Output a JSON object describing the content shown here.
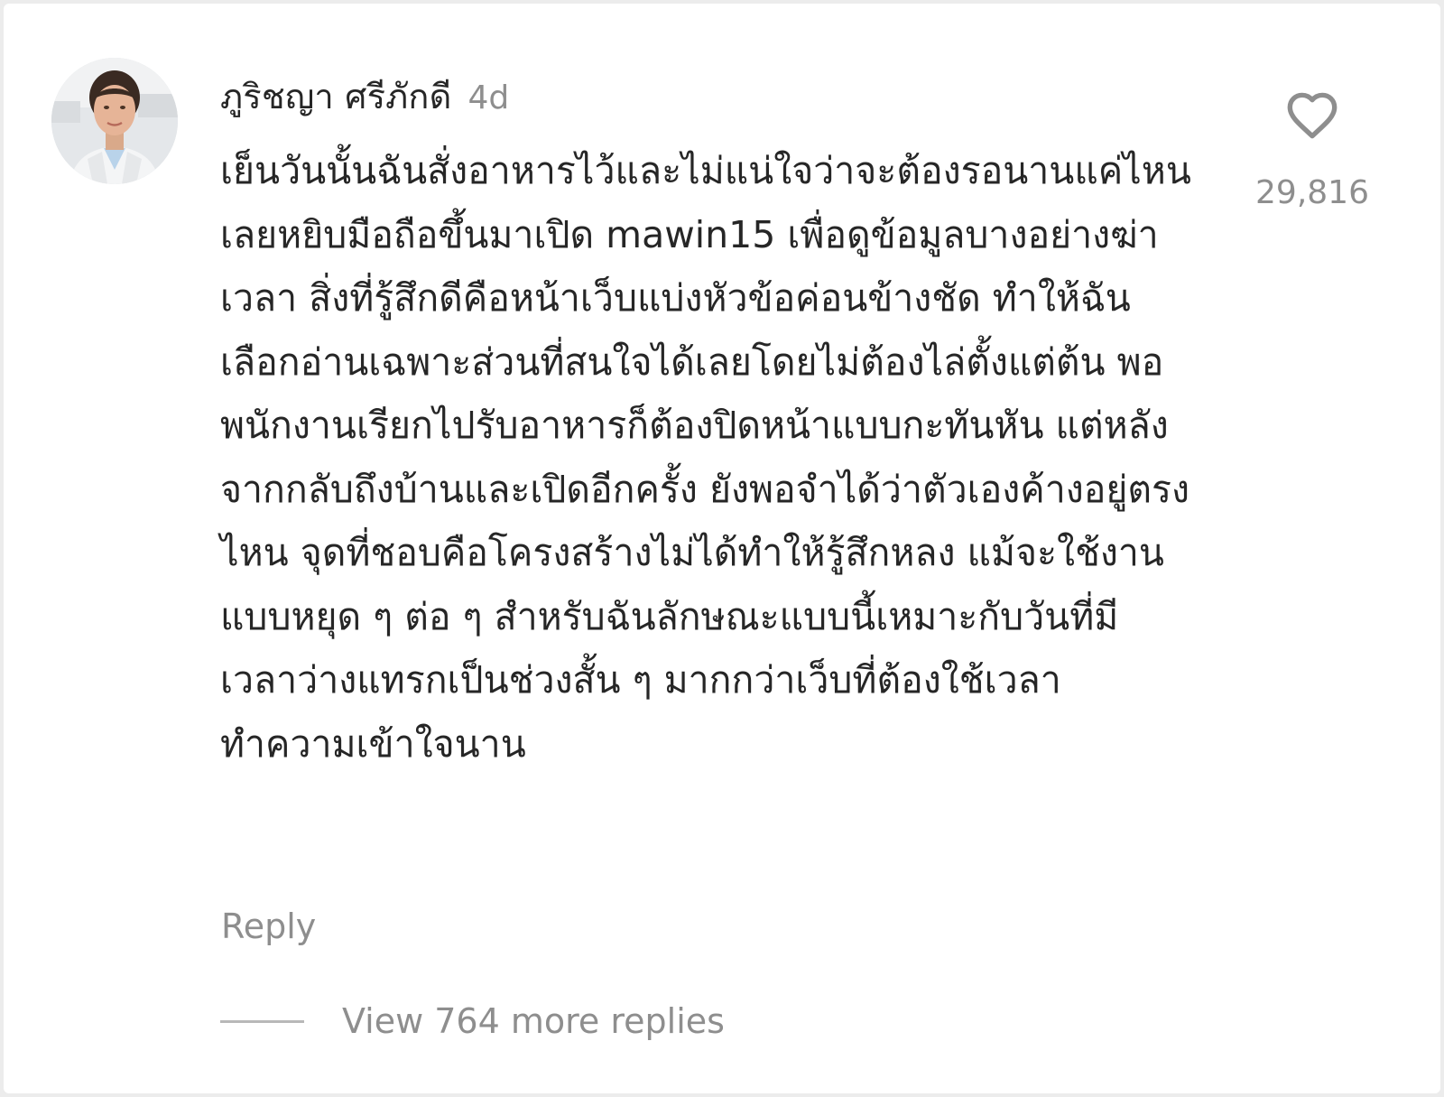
{
  "comment": {
    "username": "ภูริชญา ศรีภักดี",
    "time": "4d",
    "text": "เย็นวันนั้นฉันสั่งอาหารไว้และไม่แน่ใจว่าจะต้องรอนานแค่ไหน เลยหยิบมือถือขึ้นมาเปิด mawin15 เพื่อดูข้อมูลบางอย่างฆ่าเวลา สิ่งที่รู้สึกดีคือหน้าเว็บแบ่งหัวข้อค่อนข้างชัด ทำให้ฉันเลือกอ่านเฉพาะส่วนที่สนใจได้เลยโดยไม่ต้องไล่ตั้งแต่ต้น พอพนักงานเรียกไปรับอาหารก็ต้องปิดหน้าแบบกะทันหัน แต่หลังจากกลับถึงบ้านและเปิดอีกครั้ง ยังพอจำได้ว่าตัวเองค้างอยู่ตรงไหน จุดที่ชอบคือโครงสร้างไม่ได้ทำให้รู้สึกหลง แม้จะใช้งานแบบหยุด ๆ ต่อ ๆ สำหรับฉันลักษณะแบบนี้เหมาะกับวันที่มีเวลาว่างแทรกเป็นช่วงสั้น ๆ มากกว่าเว็บที่ต้องใช้เวลาทำความเข้าใจนาน",
    "like_count": "29,816",
    "reply_label": "Reply",
    "view_replies_label": "View 764 more replies"
  },
  "icons": {
    "like": "heart-outline-icon",
    "avatar": "profile-photo"
  },
  "colors": {
    "primary_text": "#262626",
    "secondary_text": "#8e8e8e",
    "divider": "#b8b8b8"
  }
}
